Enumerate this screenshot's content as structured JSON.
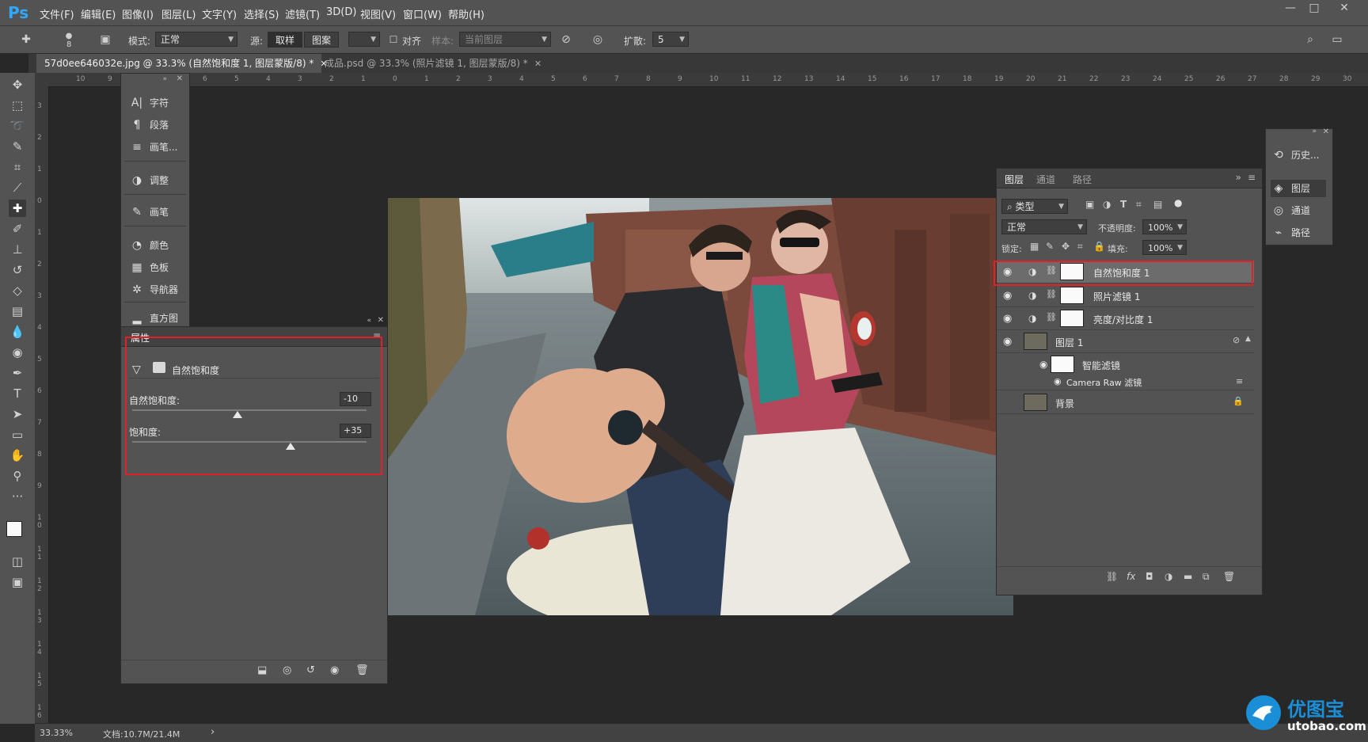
{
  "app": {
    "logo": "Ps",
    "menu": [
      "文件(F)",
      "编辑(E)",
      "图像(I)",
      "图层(L)",
      "文字(Y)",
      "选择(S)",
      "滤镜(T)",
      "3D(D)",
      "视图(V)",
      "窗口(W)",
      "帮助(H)"
    ],
    "window_controls": [
      "—",
      "□",
      "✕"
    ]
  },
  "options_bar": {
    "brush_size": "8",
    "mode_label": "模式:",
    "mode_value": "正常",
    "source_label": "源:",
    "sampled_btn": "取样",
    "pattern_btn": "图案",
    "aligned_label": "对齐",
    "sample_label": "样本:",
    "sample_value": "当前图层",
    "diffusion_label": "扩散:",
    "diffusion_value": "5"
  },
  "tabs": [
    {
      "label": "57d0ee646032e.jpg @ 33.3% (自然饱和度 1, 图层蒙版/8) *",
      "close": "✕"
    },
    {
      "label": "成品.psd @ 33.3% (照片滤镜 1, 图层蒙版/8) *",
      "close": "✕"
    }
  ],
  "hruler_ticks": [
    "10",
    "9",
    "8",
    "7",
    "6",
    "5",
    "4",
    "3",
    "2",
    "1",
    "0",
    "1",
    "2",
    "3",
    "4",
    "5",
    "6",
    "7",
    "8",
    "9",
    "10",
    "11",
    "12",
    "13",
    "14",
    "15",
    "16",
    "17",
    "18",
    "19",
    "20",
    "21",
    "22",
    "23",
    "24",
    "25",
    "26",
    "27",
    "28",
    "29",
    "30"
  ],
  "vruler_ticks": [
    "3",
    "2",
    "1",
    "0",
    "1",
    "2",
    "3",
    "4",
    "5",
    "6",
    "7",
    "8",
    "9",
    "1 0",
    "1 1",
    "1 2",
    "1 3",
    "1 4",
    "1 5",
    "1 6"
  ],
  "dock": {
    "items": [
      {
        "icon": "A|",
        "label": "字符"
      },
      {
        "icon": "¶",
        "label": "段落"
      },
      {
        "icon": "≡",
        "label": "画笔..."
      },
      {
        "icon": "◑",
        "label": "调整"
      },
      {
        "icon": "✎",
        "label": "画笔"
      },
      {
        "icon": "◔",
        "label": "颜色"
      },
      {
        "icon": "▦",
        "label": "色板"
      },
      {
        "icon": "✲",
        "label": "导航器"
      },
      {
        "icon": "▂",
        "label": "直方图"
      }
    ]
  },
  "properties": {
    "tab": "属性",
    "title": "自然饱和度",
    "vibrance_label": "自然饱和度:",
    "vibrance_value": "-10",
    "vibrance_fraction": 0.45,
    "saturation_label": "饱和度:",
    "saturation_value": "+35",
    "saturation_fraction": 0.675,
    "footer_icons": [
      "clip-icon",
      "visibility-prev-icon",
      "reset-icon",
      "eye-icon",
      "trash-icon"
    ]
  },
  "layers": {
    "tabs": [
      "图层",
      "通道",
      "路径"
    ],
    "filter_value": "类型",
    "blend_mode": "正常",
    "opacity_label": "不透明度:",
    "opacity_value": "100%",
    "lock_label": "锁定:",
    "fill_label": "填充:",
    "fill_value": "100%",
    "rows": [
      {
        "name": "自然饱和度 1"
      },
      {
        "name": "照片滤镜 1"
      },
      {
        "name": "亮度/对比度 1"
      },
      {
        "name": "图层 1"
      },
      {
        "name": "智能滤镜"
      },
      {
        "name": "Camera Raw 滤镜"
      },
      {
        "name": "背景"
      }
    ]
  },
  "mini_dock": {
    "items": [
      {
        "label": "历史..."
      },
      {
        "label": "图层"
      },
      {
        "label": "通道"
      },
      {
        "label": "路径"
      }
    ]
  },
  "status": {
    "zoom": "33.33%",
    "doc": "文档:10.7M/21.4M",
    "arrow": "›"
  },
  "watermark": {
    "cn": "优图宝",
    "url": "utobao.com"
  }
}
